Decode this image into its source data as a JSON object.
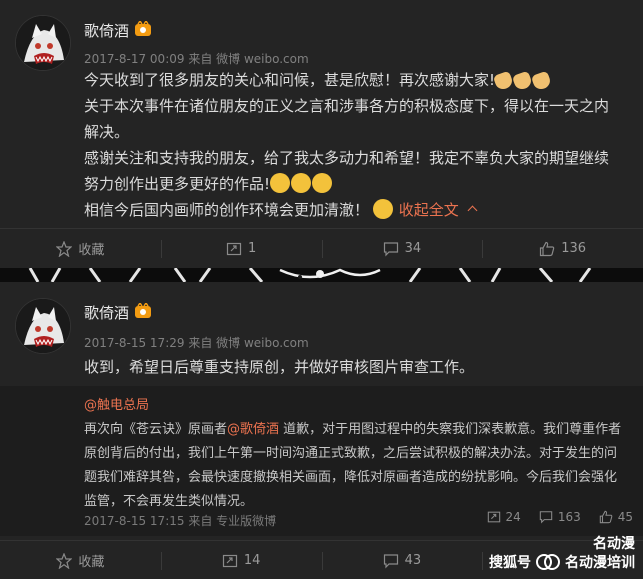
{
  "post1": {
    "username": "歌倚酒",
    "meta": "2017-8-17 00:09  来自 微博 weibo.com",
    "lines": [
      "今天收到了很多朋友的关心和问候，甚是欣慰！再次感谢大家!",
      "关于本次事件在诸位朋友的正义之言和涉事各方的积极态度下，得以在一天之内",
      "解决。",
      "感谢关注和支持我的朋友，给了我太多动力和希望！我定不辜负大家的期望继续",
      "努力创作出更多更好的作品!",
      "相信今后国内画师的创作环境会更加清澈！"
    ],
    "collapse_label": "收起全文",
    "actions": {
      "favorite": "收藏",
      "repost": "1",
      "comment": "34",
      "like": "136"
    }
  },
  "post2": {
    "username": "歌倚酒",
    "meta": "2017-8-15 17:29  来自 微博 weibo.com",
    "text": "收到，希望日后尊重支持原创，并做好审核图片审查工作。",
    "repost": {
      "author": "@触电总局",
      "line1_prefix": "再次向《苍云诀》原画者",
      "mention": "@歌倚酒",
      "line1_suffix": " 道歉，对于用图过程中的失察我们深表歉意。我们尊重作者",
      "line2": "原创背后的付出，我们上午第一时间沟通正式致歉，之后尝试积极的解决办法。对于发生的问",
      "line3": "题我们难辞其咎，会最快速度撤换相关画面，降低对原画者造成的纷扰影响。今后我们会强化",
      "line4": "监管，不会再发生类似情况。",
      "meta": "2017-8-15 17:15  来自 专业版微博",
      "stats": {
        "repost": "24",
        "comment": "163",
        "like": "45"
      }
    },
    "actions": {
      "favorite": "收藏",
      "repost": "14",
      "comment": "43"
    }
  },
  "watermark": {
    "left": "搜狐号",
    "right": "名动漫培训",
    "logo_text": "名动漫"
  }
}
